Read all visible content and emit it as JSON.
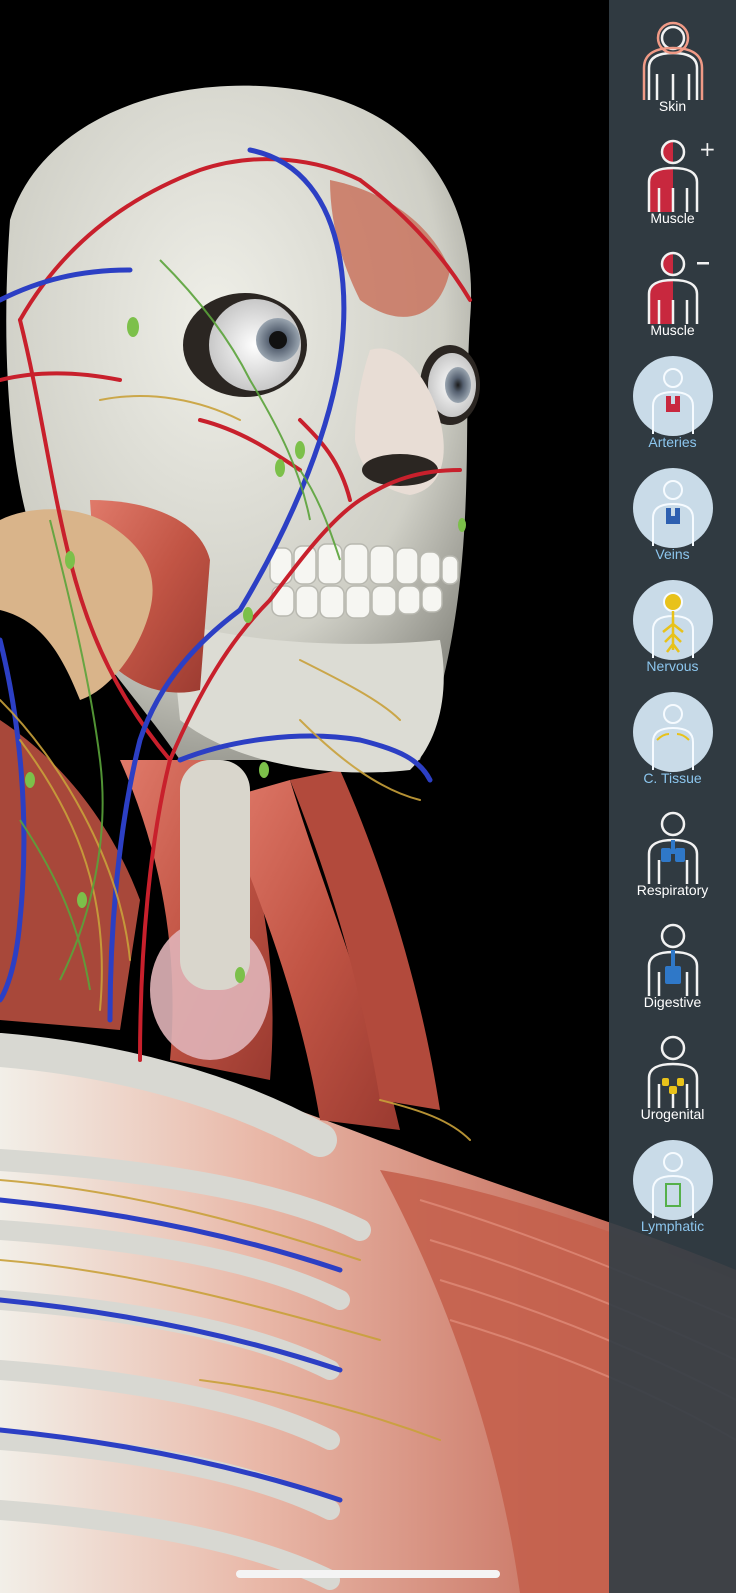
{
  "layers": [
    {
      "id": "skin",
      "label": "Skin",
      "icon": "skin-icon",
      "state": "on"
    },
    {
      "id": "muscle-add",
      "label": "Muscle",
      "icon": "muscle-add-icon",
      "modifier": "+",
      "state": "on"
    },
    {
      "id": "muscle-remove",
      "label": "Muscle",
      "icon": "muscle-remove-icon",
      "modifier": "−",
      "state": "on"
    },
    {
      "id": "arteries",
      "label": "Arteries",
      "icon": "arteries-icon",
      "state": "off"
    },
    {
      "id": "veins",
      "label": "Veins",
      "icon": "veins-icon",
      "state": "off"
    },
    {
      "id": "nervous",
      "label": "Nervous",
      "icon": "nervous-icon",
      "state": "off"
    },
    {
      "id": "connective-tissue",
      "label": "C. Tissue",
      "icon": "connective-tissue-icon",
      "state": "off"
    },
    {
      "id": "respiratory",
      "label": "Respiratory",
      "icon": "respiratory-icon",
      "state": "on"
    },
    {
      "id": "digestive",
      "label": "Digestive",
      "icon": "digestive-icon",
      "state": "on"
    },
    {
      "id": "urogenital",
      "label": "Urogenital",
      "icon": "urogenital-icon",
      "state": "on"
    },
    {
      "id": "lymphatic",
      "label": "Lymphatic",
      "icon": "lymphatic-icon",
      "state": "off"
    }
  ],
  "colors": {
    "panel": "#343e46",
    "on_label": "#ffffff",
    "off_label": "#8cc6ee",
    "off_circle": "#c9dbe8",
    "muscle": "#c8283e",
    "artery": "#c0283a",
    "vein": "#2d5fb0",
    "nerve": "#e8c21a",
    "respiratory": "#2f78c8",
    "digestive": "#2f78c8",
    "urogenital": "#e8c21a",
    "lymphatic": "#55b04a"
  }
}
